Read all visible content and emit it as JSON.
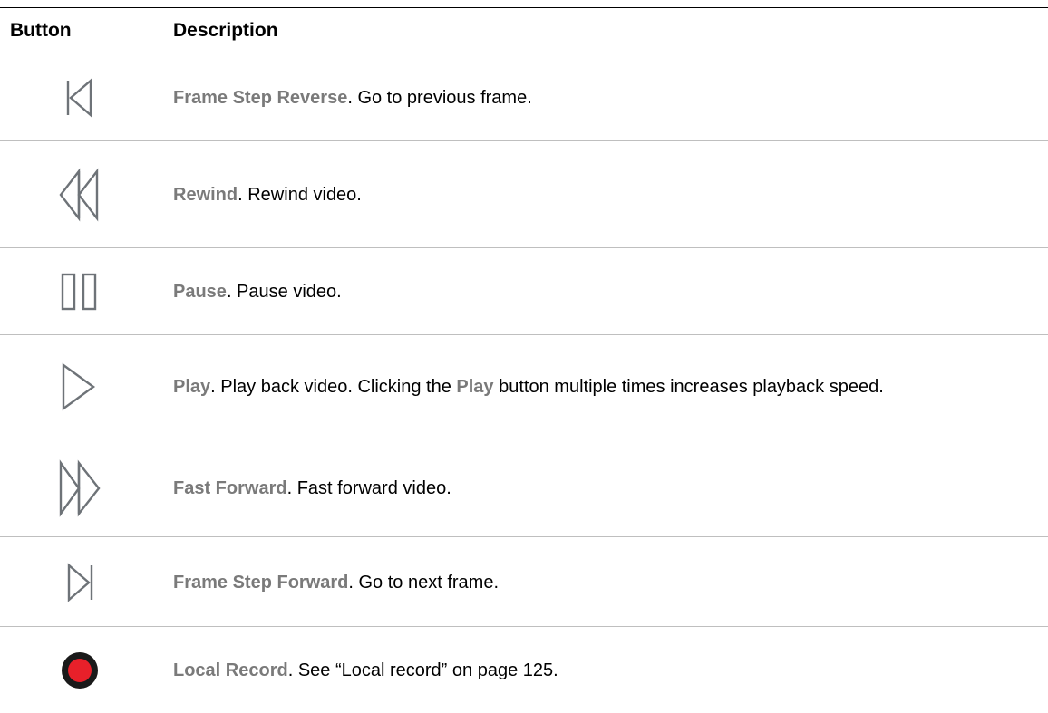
{
  "table": {
    "headers": {
      "button": "Button",
      "description": "Description"
    },
    "rows": [
      {
        "icon": "frame-step-reverse-icon",
        "term": "Frame Step Reverse",
        "text": ". Go to previous frame."
      },
      {
        "icon": "rewind-icon",
        "term": "Rewind",
        "text": ". Rewind video."
      },
      {
        "icon": "pause-icon",
        "term": "Pause",
        "text": ". Pause video."
      },
      {
        "icon": "play-icon",
        "term": "Play",
        "text_before": ". Play back video. Clicking the ",
        "term_inline": "Play",
        "text_after": " button multiple times increases playback speed."
      },
      {
        "icon": "fast-forward-icon",
        "term": "Fast Forward",
        "text": ". Fast forward video."
      },
      {
        "icon": "frame-step-forward-icon",
        "term": "Frame Step Forward",
        "text": ". Go to next frame."
      },
      {
        "icon": "local-record-icon",
        "term": "Local Record",
        "text": ". See “Local record” on page 125."
      }
    ]
  },
  "colors": {
    "icon_stroke": "#6e7378",
    "term_text": "#7a7a7a",
    "record_red": "#e8202a",
    "record_ring": "#1a1a1a",
    "row_divider": "#bfbfbf"
  }
}
